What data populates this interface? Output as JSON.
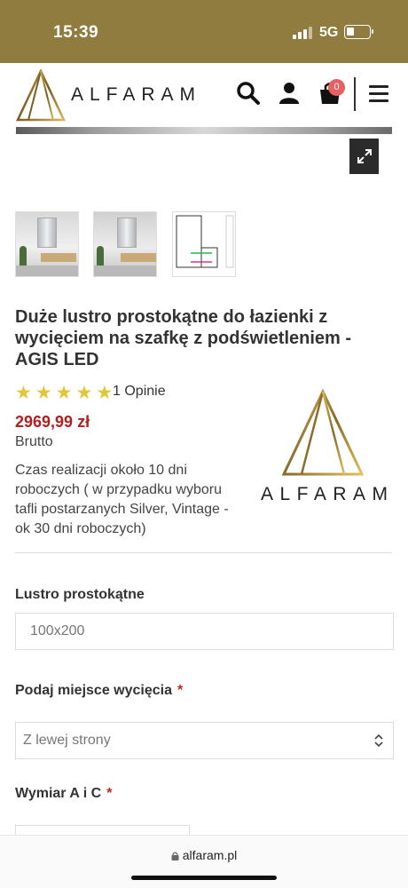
{
  "status_bar": {
    "time": "15:39",
    "network": "5G"
  },
  "header": {
    "brand": "ALFARAM",
    "cart_count": "0",
    "icons": [
      "search-icon",
      "user-icon",
      "cart-icon",
      "menu-icon"
    ]
  },
  "gallery": {
    "thumbnails": [
      "thumb-1",
      "thumb-2",
      "thumb-3"
    ]
  },
  "product": {
    "title": "Duże lustro prostokątne do łazienki z wycięciem na szafkę z podświetleniem - AGIS LED",
    "rating_stars": 5,
    "reviews": "1 Opinie",
    "price": "2969,99 zł",
    "price_note": "Brutto",
    "lead_time": "Czas realizacji około 10 dni roboczych ( w przypadku wyboru tafli postarzanych Silver, Vintage - ok 30 dni roboczych)",
    "brand_logo_text": "ALFARAM"
  },
  "form": {
    "field1": {
      "label": "Lustro prostokątne",
      "value": "100x200"
    },
    "field2": {
      "label": "Podaj miejsce wycięcia",
      "required": "*",
      "value": "Z lewej strony"
    },
    "field3": {
      "label": "Wymiar A i C",
      "required": "*"
    }
  },
  "browser": {
    "url": "alfaram.pl"
  },
  "colors": {
    "gold": "#8f7c3e",
    "price": "#b12020",
    "star": "#e4c534",
    "badge": "#e86060"
  }
}
